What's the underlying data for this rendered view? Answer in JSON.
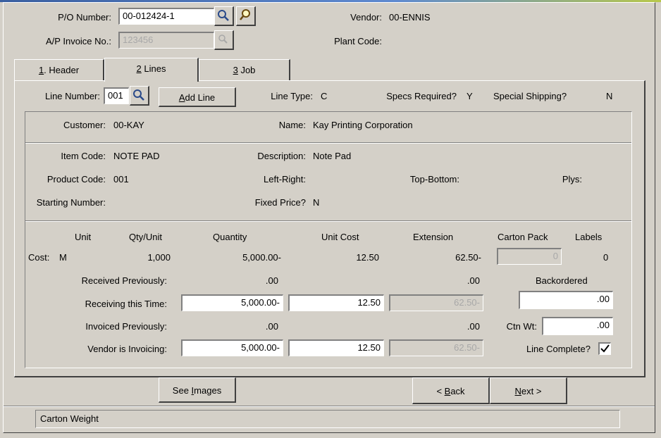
{
  "header": {
    "po_label": "P/O Number:",
    "po_value": "00-012424-1",
    "ap_label": "A/P Invoice No.:",
    "ap_value": "123456",
    "vendor_label": "Vendor:",
    "vendor_value": "00-ENNIS",
    "plant_label": "Plant Code:",
    "plant_value": ""
  },
  "tabs": [
    {
      "key": "1",
      "label": ". Header"
    },
    {
      "key": "2",
      "label": " Lines"
    },
    {
      "key": "3",
      "label": " Job"
    }
  ],
  "line": {
    "line_number_label": "Line Number:",
    "line_number_value": "001",
    "add_line_label": "Add Line",
    "line_type_label": "Line Type:",
    "line_type_value": "C",
    "specs_label": "Specs Required?",
    "specs_value": "Y",
    "special_label": "Special Shipping?",
    "special_value": "N"
  },
  "customer": {
    "customer_label": "Customer:",
    "customer_value": "00-KAY",
    "name_label": "Name:",
    "name_value": "Kay Printing Corporation"
  },
  "item": {
    "item_code_label": "Item Code:",
    "item_code_value": "NOTE PAD",
    "description_label": "Description:",
    "description_value": "Note Pad",
    "product_code_label": "Product Code:",
    "product_code_value": "001",
    "left_right_label": "Left-Right:",
    "top_bottom_label": "Top-Bottom:",
    "plys_label": "Plys:",
    "starting_number_label": "Starting Number:",
    "fixed_price_label": "Fixed Price?",
    "fixed_price_value": "N"
  },
  "costs": {
    "col_unit": "Unit",
    "col_qty_unit": "Qty/Unit",
    "col_quantity": "Quantity",
    "col_unit_cost": "Unit Cost",
    "col_extension": "Extension",
    "col_carton_pack": "Carton Pack",
    "col_labels": "Labels",
    "cost_label": "Cost:",
    "cost_unit": "M",
    "cost_qty_unit": "1,000",
    "cost_quantity": "5,000.00-",
    "cost_unit_cost": "12.50",
    "cost_extension": "62.50-",
    "carton_pack_value": "0",
    "labels_value": "0",
    "received_prev_label": "Received Previously:",
    "received_prev_qty": ".00",
    "received_prev_ext": ".00",
    "backordered_label": "Backordered",
    "receiving_label": "Receiving this Time:",
    "receiving_qty": "5,000.00-",
    "receiving_cost": "12.50",
    "receiving_ext": "62.50-",
    "backordered_value": ".00",
    "invoiced_prev_label": "Invoiced Previously:",
    "invoiced_prev_qty": ".00",
    "invoiced_prev_ext": ".00",
    "ctn_wt_label": "Ctn Wt:",
    "ctn_wt_value": ".00",
    "vendor_inv_label": "Vendor is Invoicing:",
    "vendor_inv_qty": "5,000.00-",
    "vendor_inv_cost": "12.50",
    "vendor_inv_ext": "62.50-",
    "line_complete_label": "Line Complete?",
    "line_complete_checked": true
  },
  "footer": {
    "see_images_label": "See Images",
    "back_label": "< Back",
    "next_label": "Next >"
  },
  "status": {
    "text": "Carton Weight"
  }
}
